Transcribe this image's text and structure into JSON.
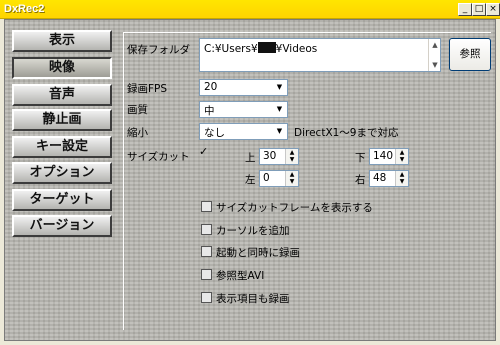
{
  "window": {
    "title": "DxRec2"
  },
  "titlebar_buttons": [
    "_",
    "□",
    "×"
  ],
  "sidebar": {
    "items": [
      {
        "label": "表示"
      },
      {
        "label": "映像"
      },
      {
        "label": "音声"
      },
      {
        "label": "静止画"
      },
      {
        "label": "キー設定"
      },
      {
        "label": "オプション"
      },
      {
        "label": "ターゲット"
      },
      {
        "label": "バージョン"
      }
    ],
    "active": "映像"
  },
  "video": {
    "save_folder_label": "保存フォルダ",
    "save_folder_path_prefix": "C:¥Users¥",
    "save_folder_path_suffix": "¥Videos",
    "browse_label": "参照",
    "fps_label": "録画FPS",
    "fps_value": "20",
    "quality_label": "画質",
    "quality_value": "中",
    "shrink_label": "縮小",
    "shrink_value": "なし",
    "shrink_note": "DirectX1～9まで対応",
    "sizecut_label": "サイズカット",
    "sizecut_checked": true,
    "top_label": "上",
    "top_value": "30",
    "bottom_label": "下",
    "bottom_value": "140",
    "left_label": "左",
    "left_value": "0",
    "right_label": "右",
    "right_value": "48",
    "options": [
      {
        "label": "サイズカットフレームを表示する",
        "checked": false
      },
      {
        "label": "カーソルを追加",
        "checked": false
      },
      {
        "label": "起動と同時に録画",
        "checked": false
      },
      {
        "label": "参照型AVI",
        "checked": false
      },
      {
        "label": "表示項目も録画",
        "checked": false
      }
    ]
  }
}
